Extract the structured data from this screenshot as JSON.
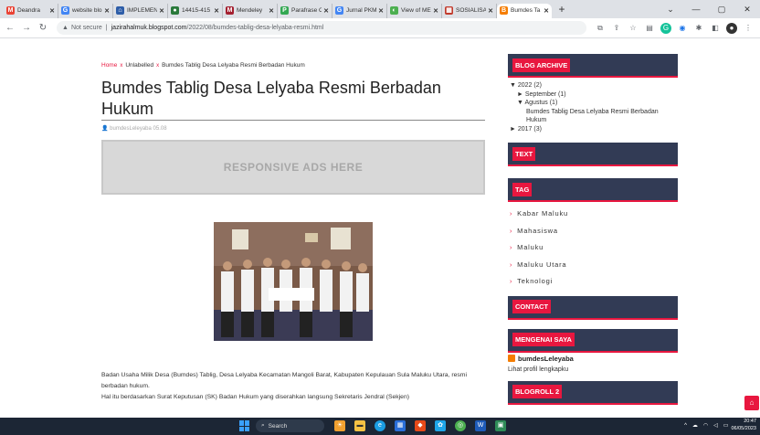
{
  "browser": {
    "tabs": [
      {
        "title": "Deandra",
        "fav_text": "M",
        "fav_color": "#ea4335"
      },
      {
        "title": "website blo",
        "fav_text": "G",
        "fav_color": "#4285f4"
      },
      {
        "title": "IMPLEMEN",
        "fav_text": "⌂",
        "fav_color": "#2d5da8"
      },
      {
        "title": "14415-415",
        "fav_text": "●",
        "fav_color": "#2a7a3b"
      },
      {
        "title": "Mendeley",
        "fav_text": "M",
        "fav_color": "#a42030"
      },
      {
        "title": "Parafrase C",
        "fav_text": "P",
        "fav_color": "#33a852"
      },
      {
        "title": "Jurnal PKM",
        "fav_text": "G",
        "fav_color": "#4285f4"
      },
      {
        "title": "View of ME",
        "fav_text": "◐",
        "fav_color": "#4caf50"
      },
      {
        "title": "SOSIALISA",
        "fav_text": "▦",
        "fav_color": "#c0392b"
      },
      {
        "title": "Bumdes Ta",
        "fav_text": "B",
        "fav_color": "#f57d00"
      }
    ],
    "new_tab_label": "+",
    "url": {
      "security": "Not secure",
      "host": "jazirahalmuk.blogspot.com",
      "path": "/2022/08/bumdes-tablig-desa-lelyaba-resmi.html"
    }
  },
  "post": {
    "breadcrumb": {
      "home": "Home",
      "category": "Unlabelled",
      "current": "Bumdes Tablig Desa Lelyaba Resmi Berbadan Hukum"
    },
    "title": "Bumdes Tablig Desa Lelyaba Resmi Berbadan Hukum",
    "meta": "bumdesLeleyaba  05.08",
    "ads_text": "RESPONSIVE ADS HERE",
    "body": [
      "Badan Usaha Milik Desa (Bumdes) Tablig, Desa Lelyaba Kecamatan Mangoli Barat, Kabupaten Kepulauan Sula Maluku Utara, resmi berbadan hukum.",
      "Hal itu berdasarkan Surat Keputusan (SK) Badan Hukum yang diserahkan langsung Sekretaris Jendral (Sekjen)"
    ]
  },
  "sidebar": {
    "archive_title": "BLOG ARCHIVE",
    "archive": [
      {
        "level": 1,
        "text": "▼  2022 (2)"
      },
      {
        "level": 2,
        "text": "►  September (1)"
      },
      {
        "level": 2,
        "text": "▼  Agustus (1)"
      },
      {
        "level": 3,
        "text": "Bumdes Tablig Desa Lelyaba Resmi Berbadan Hukum"
      },
      {
        "level": 1,
        "text": "►  2017 (3)"
      }
    ],
    "text_title": "TEXT",
    "tag_title": "TAG",
    "tags": [
      "Kabar Maluku",
      "Mahasiswa",
      "Maluku",
      "Maluku Utara",
      "Teknologi"
    ],
    "contact_title": "CONTACT",
    "about_title": "MENGENAI SAYA",
    "profile_name": "bumdesLeleyaba",
    "profile_link": "Lihat profil lengkapku",
    "blogroll_title": "BLOGROLL 2"
  },
  "taskbar": {
    "search_label": "Search",
    "time": "20:47",
    "date": "06/05/2023"
  },
  "colors": {
    "accent": "#e8173f",
    "widget_bg": "#323b55"
  }
}
